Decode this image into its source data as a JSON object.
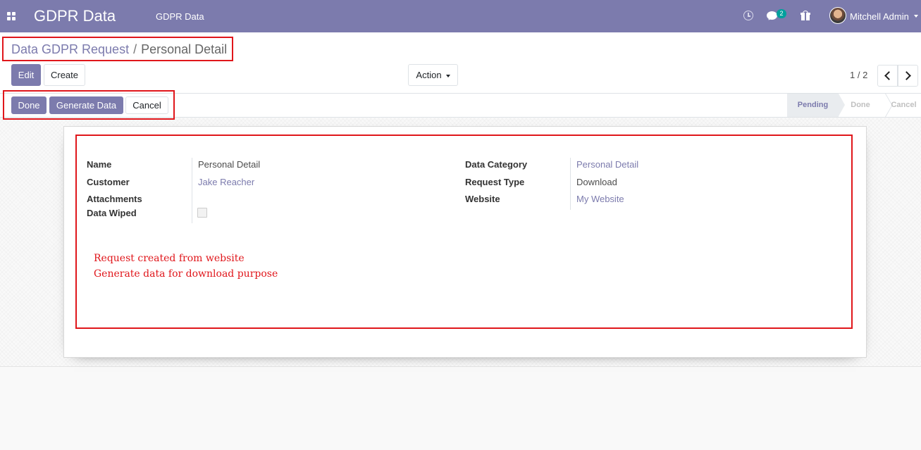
{
  "navbar": {
    "app_title": "GDPR Data",
    "menu_item": "GDPR Data",
    "chat_badge": "2",
    "user_name": "Mitchell Admin"
  },
  "breadcrumb": {
    "parent": "Data GDPR Request",
    "separator": "/",
    "current": "Personal Detail"
  },
  "toolbar": {
    "edit_label": "Edit",
    "create_label": "Create",
    "action_label": "Action",
    "pager_value": "1 / 2"
  },
  "header_buttons": {
    "done_label": "Done",
    "generate_label": "Generate Data",
    "cancel_label": "Cancel"
  },
  "stages": {
    "pending": "Pending",
    "done": "Done",
    "cancel": "Cancel",
    "active": "Pending"
  },
  "form": {
    "left": {
      "name_label": "Name",
      "name_value": "Personal Detail",
      "customer_label": "Customer",
      "customer_value": "Jake Reacher",
      "attachments_label": "Attachments",
      "data_wiped_label": "Data Wiped",
      "data_wiped_checked": false
    },
    "right": {
      "data_category_label": "Data Category",
      "data_category_value": "Personal Detail",
      "request_type_label": "Request Type",
      "request_type_value": "Download",
      "website_label": "Website",
      "website_value": "My Website"
    }
  },
  "annotations": {
    "line1": "Request created from website",
    "line2": "Generate data for download purpose"
  },
  "colors": {
    "brand": "#7c7bad",
    "highlight": "#e0161b",
    "badge": "#00a09d"
  }
}
